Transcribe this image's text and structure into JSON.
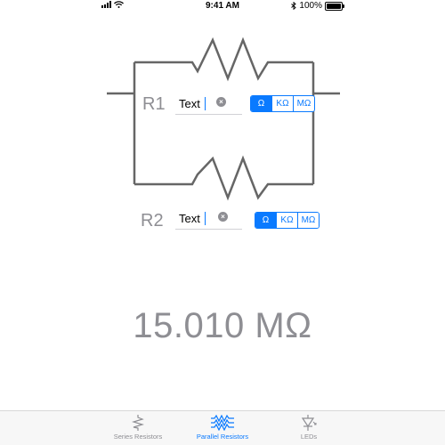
{
  "status_bar": {
    "time": "9:41 AM",
    "battery": "100%"
  },
  "resistor_1": {
    "label": "R1",
    "input_value": "Text",
    "units": [
      "Ω",
      "KΩ",
      "MΩ"
    ],
    "selected_unit": "Ω"
  },
  "resistor_2": {
    "label": "R2",
    "input_value": "Text",
    "units": [
      "Ω",
      "KΩ",
      "MΩ"
    ],
    "selected_unit": "Ω"
  },
  "result": {
    "value": "15.010 MΩ"
  },
  "tab_bar": {
    "tabs": [
      {
        "label": "Series Resistors",
        "icon": "series-resistor-icon"
      },
      {
        "label": "Parallel Resistors",
        "icon": "parallel-resistor-icon"
      },
      {
        "label": "LEDs",
        "icon": "led-icon"
      }
    ],
    "active": "Parallel Resistors"
  },
  "colors": {
    "accent": "#0a7aff",
    "muted": "#8e8e93",
    "wire": "#666666"
  }
}
